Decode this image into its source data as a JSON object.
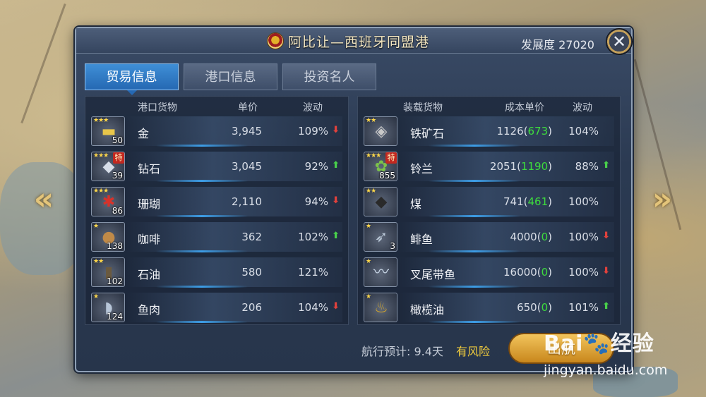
{
  "header": {
    "title": "阿比让—西班牙同盟港",
    "dev_label": "发展度 27020",
    "close_symbol": "✕"
  },
  "nav": {
    "left_arrow": "«",
    "right_arrow": "»"
  },
  "tabs": [
    {
      "label": "贸易信息",
      "active": true
    },
    {
      "label": "港口信息",
      "active": false
    },
    {
      "label": "投资名人",
      "active": false
    }
  ],
  "left_table": {
    "headers": {
      "goods": "港口货物",
      "price": "单价",
      "fluct": "波动"
    },
    "rows": [
      {
        "name": "金",
        "stars": "★★★",
        "qty": "50",
        "special": "",
        "icon": "gold-bar-icon",
        "glyph": "▬",
        "glyph_color": "#e8c64a",
        "price": "3,945",
        "fluct": "109%",
        "trend": "down"
      },
      {
        "name": "钻石",
        "stars": "★★★",
        "qty": "39",
        "special": "特",
        "icon": "diamond-icon",
        "glyph": "◆",
        "glyph_color": "#d6dde8",
        "price": "3,045",
        "fluct": "92%",
        "trend": "up"
      },
      {
        "name": "珊瑚",
        "stars": "★★★",
        "qty": "86",
        "special": "",
        "icon": "coral-icon",
        "glyph": "✱",
        "glyph_color": "#d8322a",
        "price": "2,110",
        "fluct": "94%",
        "trend": "down"
      },
      {
        "name": "咖啡",
        "stars": "★",
        "qty": "138",
        "special": "",
        "icon": "coffee-beans-icon",
        "glyph": "●",
        "glyph_color": "#c08a48",
        "price": "362",
        "fluct": "102%",
        "trend": "up"
      },
      {
        "name": "石油",
        "stars": "★★",
        "qty": "102",
        "special": "",
        "icon": "oil-barrel-icon",
        "glyph": "▮",
        "glyph_color": "#6a5a40",
        "price": "580",
        "fluct": "121%",
        "trend": "none"
      },
      {
        "name": "鱼肉",
        "stars": "★",
        "qty": "124",
        "special": "",
        "icon": "fish-meat-icon",
        "glyph": "◗",
        "glyph_color": "#b8c6d8",
        "price": "206",
        "fluct": "104%",
        "trend": "down"
      }
    ]
  },
  "right_table": {
    "headers": {
      "goods": "装载货物",
      "price": "成本单价",
      "fluct": "波动"
    },
    "rows": [
      {
        "name": "铁矿石",
        "stars": "★★",
        "qty": "",
        "special": "",
        "icon": "iron-ore-icon",
        "glyph": "◈",
        "glyph_color": "#c9c9c9",
        "price_main": "1126",
        "price_paren": "673",
        "fluct": "104%",
        "trend": "none"
      },
      {
        "name": "铃兰",
        "stars": "★★★",
        "qty": "855",
        "special": "特",
        "icon": "lily-of-valley-icon",
        "glyph": "✿",
        "glyph_color": "#7cc24a",
        "price_main": "2051",
        "price_paren": "1190",
        "fluct": "88%",
        "trend": "up"
      },
      {
        "name": "煤",
        "stars": "★★",
        "qty": "",
        "special": "",
        "icon": "coal-icon",
        "glyph": "◆",
        "glyph_color": "#2a2a2a",
        "price_main": "741",
        "price_paren": "461",
        "fluct": "100%",
        "trend": "none"
      },
      {
        "name": "鲱鱼",
        "stars": "★",
        "qty": "3",
        "special": "",
        "icon": "herring-icon",
        "glyph": "➶",
        "glyph_color": "#b9c7d6",
        "price_main": "4000",
        "price_paren": "0",
        "fluct": "100%",
        "trend": "down"
      },
      {
        "name": "叉尾带鱼",
        "stars": "★",
        "qty": "",
        "special": "",
        "icon": "hairtail-fish-icon",
        "glyph": "〰",
        "glyph_color": "#c6d4e4",
        "price_main": "16000",
        "price_paren": "0",
        "fluct": "100%",
        "trend": "down"
      },
      {
        "name": "橄榄油",
        "stars": "★",
        "qty": "",
        "special": "",
        "icon": "olive-oil-icon",
        "glyph": "♨",
        "glyph_color": "#d4a62a",
        "price_main": "650",
        "price_paren": "0",
        "fluct": "101%",
        "trend": "up"
      }
    ]
  },
  "footer": {
    "voyage": "航行预计: 9.4天",
    "risk": "有风险",
    "depart": "出航"
  },
  "watermark": {
    "logo": "Bai🐾经验",
    "url": "jingyan.baidu.com"
  },
  "colors": {
    "up": "#49d04b",
    "down": "#e0413c",
    "tab_active": "#2e7cc7",
    "risk": "#f1cc3d"
  }
}
